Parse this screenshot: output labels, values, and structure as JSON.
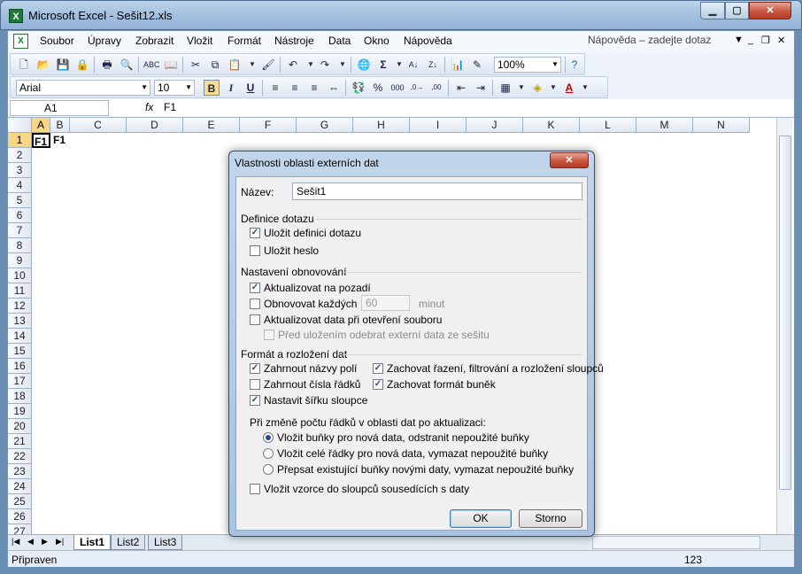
{
  "window": {
    "title": "Microsoft Excel - Sešit12.xls",
    "app_icon": "X"
  },
  "menu": {
    "items": [
      "Soubor",
      "Úpravy",
      "Zobrazit",
      "Vložit",
      "Formát",
      "Nástroje",
      "Data",
      "Okno",
      "Nápověda"
    ],
    "help_placeholder": "Nápověda – zadejte dotaz"
  },
  "toolbar": {
    "zoom": "100%",
    "font": "Arial",
    "font_size": "10"
  },
  "formula_bar": {
    "name_box": "A1",
    "fx": "fx",
    "formula": "F1"
  },
  "grid": {
    "columns": [
      "A",
      "B",
      "C",
      "D",
      "E",
      "F",
      "G",
      "H",
      "I",
      "J",
      "K",
      "L",
      "M",
      "N"
    ],
    "rows": [
      "1",
      "2",
      "3",
      "4",
      "5",
      "6",
      "7",
      "8",
      "9",
      "10",
      "11",
      "12",
      "13",
      "14",
      "15",
      "16",
      "17",
      "18",
      "19",
      "20",
      "21",
      "22",
      "23",
      "24",
      "25",
      "26",
      "27"
    ],
    "cells": {
      "A1": "F1",
      "B1": "F1"
    }
  },
  "sheets": {
    "tabs": [
      "List1",
      "List2",
      "List3"
    ]
  },
  "status": {
    "text": "Připraven",
    "number": "123"
  },
  "dialog": {
    "title": "Vlastnosti oblasti externích dat",
    "name_label": "Název:",
    "name_value": "Sešit1",
    "query_section": "Definice dotazu",
    "save_query": "Uložit definici dotazu",
    "save_password": "Uložit heslo",
    "refresh_section": "Nastavení obnovování",
    "background_refresh": "Aktualizovat na pozadí",
    "refresh_every": "Obnovovat každých",
    "refresh_minutes_value": "60",
    "minutes_unit": "minut",
    "refresh_on_open": "Aktualizovat data při otevření souboru",
    "remove_before_save": "Před uložením odebrat externí data ze sešitu",
    "format_section": "Formát a rozložení dat",
    "include_field_names": "Zahrnout názvy polí",
    "include_row_numbers": "Zahrnout čísla řádků",
    "adjust_column_width": "Nastavit šířku sloupce",
    "preserve_sort": "Zachovat řazení, filtrování a rozložení sloupců",
    "preserve_cell_format": "Zachovat formát buněk",
    "rows_change_label": "Při změně počtu řádků v oblasti dat po aktualizaci:",
    "radio_insert_cells": "Vložit buňky pro nová data, odstranit nepoužité buňky",
    "radio_insert_rows": "Vložit celé řádky pro nová data, vymazat nepoužité buňky",
    "radio_overwrite": "Přepsat existující buňky novými daty, vymazat nepoužité buňky",
    "fill_formulas": "Vložit vzorce do sloupců sousedících s daty",
    "ok": "OK",
    "cancel": "Storno"
  }
}
